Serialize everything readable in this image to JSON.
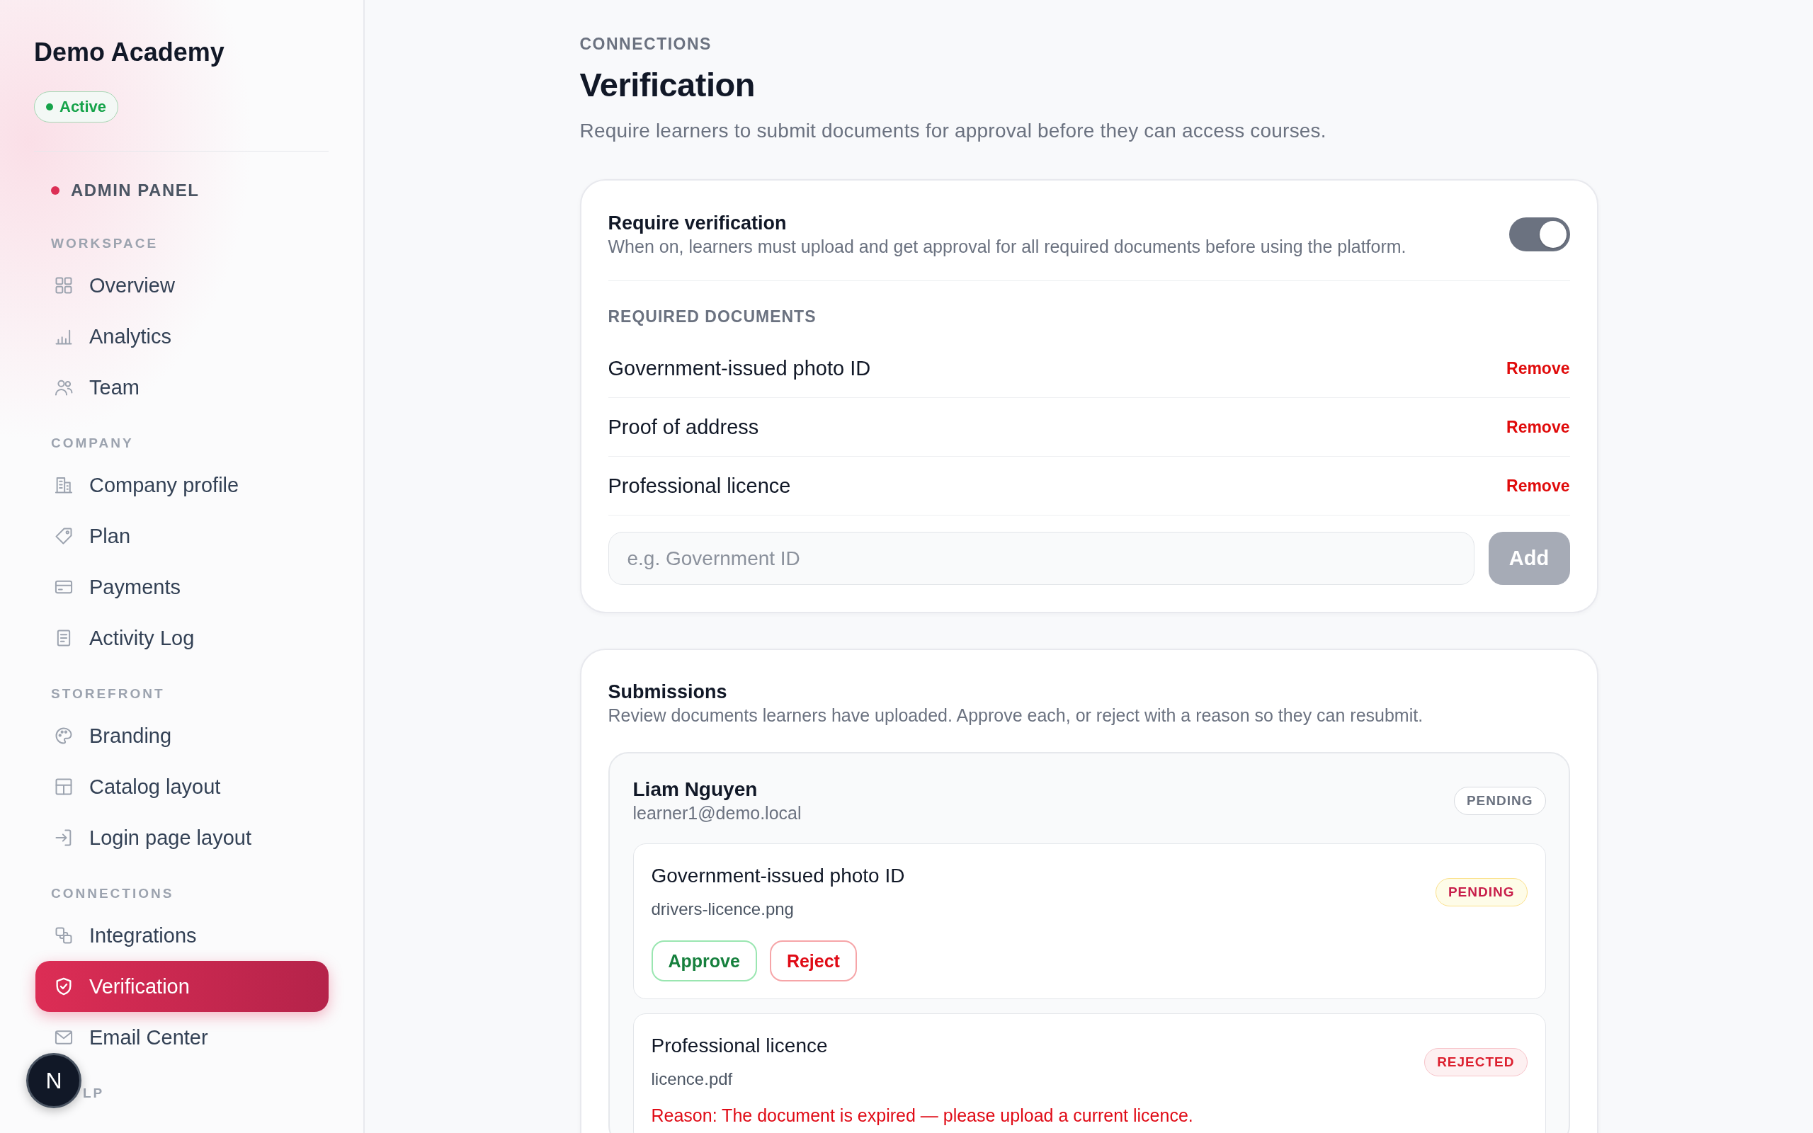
{
  "sidebar": {
    "brand": "Demo Academy",
    "status": {
      "label": "Active",
      "kind": "active"
    },
    "panel_label": "ADMIN PANEL",
    "sections": [
      {
        "title": "WORKSPACE",
        "items": [
          {
            "label": "Overview",
            "selected": false
          },
          {
            "label": "Analytics",
            "selected": false
          },
          {
            "label": "Team",
            "selected": false
          }
        ]
      },
      {
        "title": "COMPANY",
        "items": [
          {
            "label": "Company profile",
            "selected": false
          },
          {
            "label": "Plan",
            "selected": false
          },
          {
            "label": "Payments",
            "selected": false
          },
          {
            "label": "Activity Log",
            "selected": false
          }
        ]
      },
      {
        "title": "STOREFRONT",
        "items": [
          {
            "label": "Branding",
            "selected": false
          },
          {
            "label": "Catalog layout",
            "selected": false
          },
          {
            "label": "Login page layout",
            "selected": false
          }
        ]
      },
      {
        "title": "CONNECTIONS",
        "items": [
          {
            "label": "Integrations",
            "selected": false
          },
          {
            "label": "Verification",
            "selected": true
          },
          {
            "label": "Email Center",
            "selected": false
          }
        ]
      }
    ],
    "covered_section_label": "LP"
  },
  "floating_button": {
    "label": "N"
  },
  "header": {
    "eyebrow": "CONNECTIONS",
    "title": "Verification",
    "subtitle": "Require learners to submit documents for approval before they can access courses."
  },
  "settings_card": {
    "toggle": {
      "label": "Require verification",
      "description": "When on, learners must upload and get approval for all required documents before using the platform.",
      "on": true
    },
    "documents_heading": "REQUIRED DOCUMENTS",
    "documents": [
      {
        "name": "Government-issued photo ID",
        "action": "Remove"
      },
      {
        "name": "Proof of address",
        "action": "Remove"
      },
      {
        "name": "Professional licence",
        "action": "Remove"
      }
    ],
    "new_document": {
      "placeholder": "e.g. Government ID"
    },
    "add_button": {
      "label": "Add",
      "disabled": true
    }
  },
  "submissions": {
    "title": "Submissions",
    "description": "Review documents learners have uploaded. Approve each, or reject with a reason so they can resubmit.",
    "learners": [
      {
        "name": "Liam Nguyen",
        "email": "learner1@demo.local",
        "status": {
          "label": "PENDING",
          "kind": "pending"
        },
        "documents": [
          {
            "name": "Government-issued photo ID",
            "file": "drivers-licence.png",
            "status": {
              "label": "PENDING",
              "kind": "pending"
            },
            "actions": [
              {
                "label": "Approve",
                "kind": "approve"
              },
              {
                "label": "Reject",
                "kind": "reject"
              }
            ]
          },
          {
            "name": "Professional licence",
            "file": "licence.pdf",
            "status": {
              "label": "REJECTED",
              "kind": "rejected"
            },
            "reason": "Reason: The document is expired — please upload a current licence."
          }
        ]
      }
    ]
  }
}
